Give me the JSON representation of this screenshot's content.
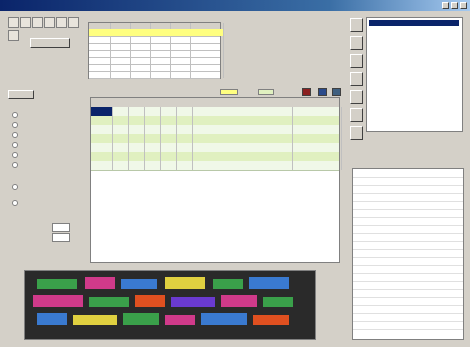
{
  "window": {
    "title": ""
  },
  "toolbar": {
    "icons": [
      "new-icon",
      "open-icon",
      "save-icon",
      "print-icon",
      "cut-icon",
      "copy-icon",
      "paste-icon",
      "help-icon"
    ]
  },
  "top_left_button": {
    "label": ""
  },
  "top_grid": {
    "header": [
      "",
      "",
      "",
      "",
      "",
      ""
    ],
    "rows": [
      [
        "",
        "",
        "",
        "",
        "",
        ""
      ],
      [
        "",
        "",
        "",
        "",
        "",
        ""
      ],
      [
        "",
        "",
        "",
        "",
        "",
        ""
      ],
      [
        "",
        "",
        "",
        "",
        "",
        ""
      ],
      [
        "",
        "",
        "",
        "",
        "",
        ""
      ],
      [
        "",
        "",
        "",
        "",
        "",
        ""
      ],
      [
        "",
        "",
        "",
        "",
        "",
        ""
      ]
    ]
  },
  "tab_bar": {
    "label": ""
  },
  "left_panel": {
    "group_label": "",
    "options": [
      "",
      "",
      "",
      "",
      "",
      ""
    ],
    "group2_label": "",
    "options2": [
      "",
      ""
    ],
    "field1_label": "",
    "field1_value": "",
    "field2_label": "",
    "field2_value": ""
  },
  "legend_badges": {
    "first": "",
    "second": ""
  },
  "main_grid": {
    "rows": [
      [
        "",
        "",
        "",
        "",
        "",
        "",
        "",
        ""
      ],
      [
        "",
        "",
        "",
        "",
        "",
        "",
        "",
        ""
      ],
      [
        "",
        "",
        "",
        "",
        "",
        "",
        "",
        ""
      ],
      [
        "",
        "",
        "",
        "",
        "",
        "",
        "",
        ""
      ],
      [
        "",
        "",
        "",
        "",
        "",
        "",
        "",
        ""
      ],
      [
        "",
        "",
        "",
        "",
        "",
        "",
        "",
        ""
      ],
      [
        "",
        "",
        "",
        "",
        "",
        "",
        "",
        ""
      ]
    ]
  },
  "tree": {
    "items": [
      "",
      "",
      "",
      "",
      "",
      "",
      "",
      "",
      "",
      "",
      "",
      "",
      ""
    ]
  },
  "properties": {
    "rows": [
      [
        "",
        ""
      ],
      [
        "",
        ""
      ],
      [
        "",
        ""
      ],
      [
        "",
        ""
      ],
      [
        "",
        ""
      ],
      [
        "",
        ""
      ],
      [
        "",
        ""
      ],
      [
        "",
        ""
      ],
      [
        "",
        ""
      ],
      [
        "",
        ""
      ],
      [
        "",
        ""
      ],
      [
        "",
        ""
      ],
      [
        "",
        ""
      ],
      [
        "",
        ""
      ],
      [
        "",
        ""
      ],
      [
        "",
        ""
      ],
      [
        "",
        ""
      ],
      [
        "",
        ""
      ],
      [
        "",
        ""
      ],
      [
        "",
        ""
      ]
    ]
  },
  "colors": {
    "titlebar": "#0a246a",
    "highlight": "#ffff80",
    "grid_line": "#b8c8a8"
  }
}
